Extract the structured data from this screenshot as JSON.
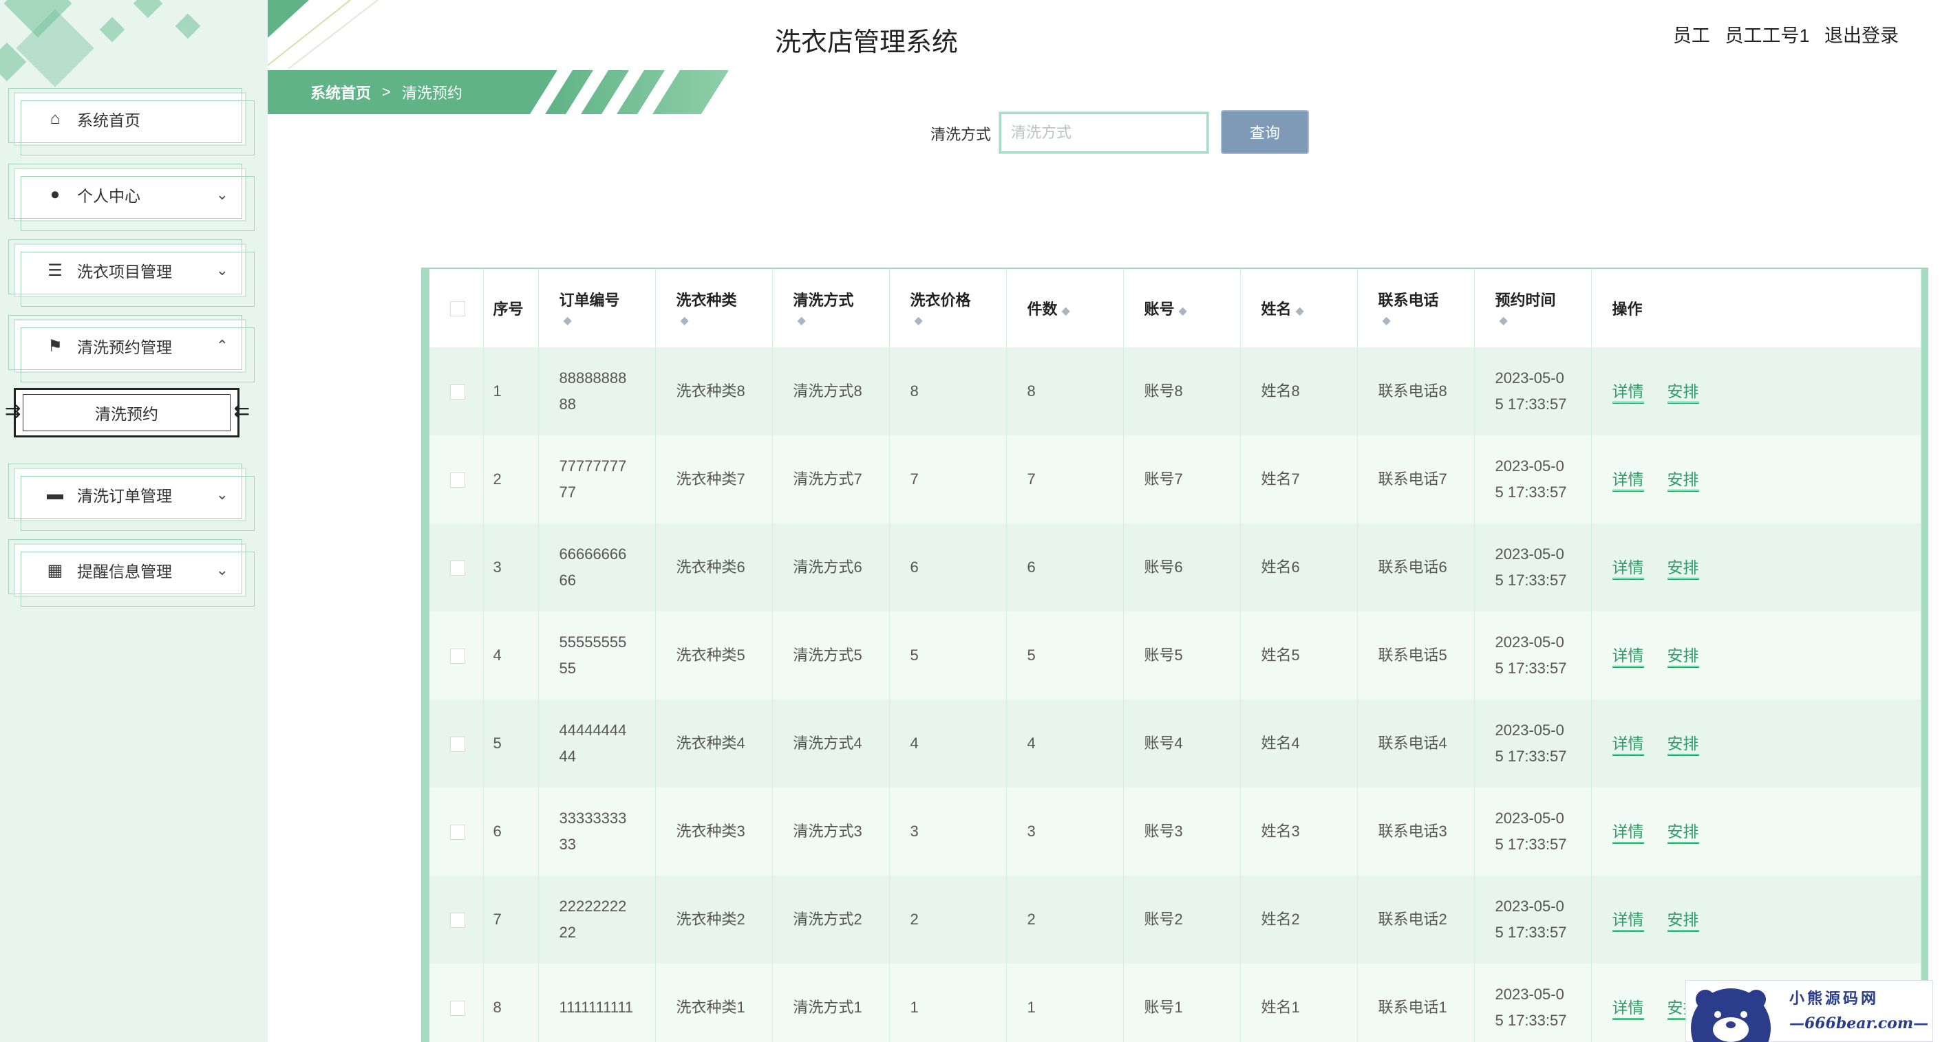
{
  "app": {
    "title": "洗衣店管理系统",
    "user_role": "员工",
    "user_name": "员工工号1",
    "logout": "退出登录"
  },
  "sidebar": {
    "items": [
      {
        "label": "系统首页",
        "icon": "home-icon",
        "chevron": ""
      },
      {
        "label": "个人中心",
        "icon": "user-icon",
        "chevron": "⌄"
      },
      {
        "label": "洗衣项目管理",
        "icon": "sliders-icon",
        "chevron": "⌄"
      },
      {
        "label": "清洗预约管理",
        "icon": "flag-icon",
        "chevron": "⌃"
      },
      {
        "label": "清洗订单管理",
        "icon": "monitor-icon",
        "chevron": "⌄"
      },
      {
        "label": "提醒信息管理",
        "icon": "grid-icon",
        "chevron": "⌄"
      }
    ],
    "sub_item": "清洗预约"
  },
  "breadcrumb": {
    "home": "系统首页",
    "separator": ">",
    "current": "清洗预约"
  },
  "search": {
    "label": "清洗方式",
    "placeholder": "清洗方式",
    "button": "查询"
  },
  "table": {
    "headers": [
      "序号",
      "订单编号",
      "洗衣种类",
      "清洗方式",
      "洗衣价格",
      "件数",
      "账号",
      "姓名",
      "联系电话",
      "预约时间",
      "操作"
    ],
    "rows": [
      {
        "index": "1",
        "order": "8888888888",
        "type": "洗衣种类8",
        "method": "清洗方式8",
        "price": "8",
        "count": "8",
        "account": "账号8",
        "name": "姓名8",
        "phone": "联系电话8",
        "time": "2023-05-05 17:33:57"
      },
      {
        "index": "2",
        "order": "7777777777",
        "type": "洗衣种类7",
        "method": "清洗方式7",
        "price": "7",
        "count": "7",
        "account": "账号7",
        "name": "姓名7",
        "phone": "联系电话7",
        "time": "2023-05-05 17:33:57"
      },
      {
        "index": "3",
        "order": "6666666666",
        "type": "洗衣种类6",
        "method": "清洗方式6",
        "price": "6",
        "count": "6",
        "account": "账号6",
        "name": "姓名6",
        "phone": "联系电话6",
        "time": "2023-05-05 17:33:57"
      },
      {
        "index": "4",
        "order": "5555555555",
        "type": "洗衣种类5",
        "method": "清洗方式5",
        "price": "5",
        "count": "5",
        "account": "账号5",
        "name": "姓名5",
        "phone": "联系电话5",
        "time": "2023-05-05 17:33:57"
      },
      {
        "index": "5",
        "order": "4444444444",
        "type": "洗衣种类4",
        "method": "清洗方式4",
        "price": "4",
        "count": "4",
        "account": "账号4",
        "name": "姓名4",
        "phone": "联系电话4",
        "time": "2023-05-05 17:33:57"
      },
      {
        "index": "6",
        "order": "3333333333",
        "type": "洗衣种类3",
        "method": "清洗方式3",
        "price": "3",
        "count": "3",
        "account": "账号3",
        "name": "姓名3",
        "phone": "联系电话3",
        "time": "2023-05-05 17:33:57"
      },
      {
        "index": "7",
        "order": "2222222222",
        "type": "洗衣种类2",
        "method": "清洗方式2",
        "price": "2",
        "count": "2",
        "account": "账号2",
        "name": "姓名2",
        "phone": "联系电话2",
        "time": "2023-05-05 17:33:57"
      },
      {
        "index": "8",
        "order": "1111111111",
        "type": "洗衣种类1",
        "method": "清洗方式1",
        "price": "1",
        "count": "1",
        "account": "账号1",
        "name": "姓名1",
        "phone": "联系电话1",
        "time": "2023-05-05 17:33:57"
      }
    ],
    "actions": {
      "detail": "详情",
      "arrange": "安排"
    }
  },
  "watermark": {
    "line1": "小熊源码网",
    "line2": "—666bear.com—"
  },
  "colors": {
    "accent": "#5fb386",
    "sidebar_bg": "#e8f5ee",
    "row_odd": "#e7f5ee",
    "row_even": "#f2faf6",
    "link": "#2f9e69",
    "button": "#7f9ab6"
  }
}
